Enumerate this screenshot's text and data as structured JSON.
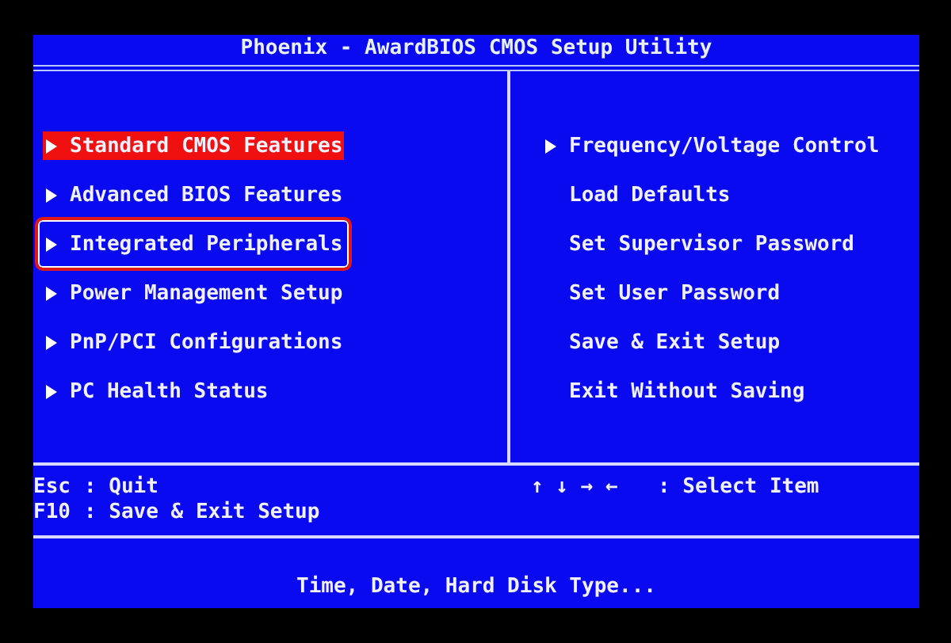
{
  "window": {
    "title": "Phoenix - AwardBIOS CMOS Setup Utility"
  },
  "left_menu": [
    {
      "label": "Standard CMOS Features",
      "arrow": true,
      "selected": true,
      "highlighted": false
    },
    {
      "label": "Advanced BIOS Features",
      "arrow": true,
      "selected": false,
      "highlighted": false
    },
    {
      "label": "Integrated Peripherals",
      "arrow": true,
      "selected": false,
      "highlighted": true
    },
    {
      "label": "Power Management Setup",
      "arrow": true,
      "selected": false,
      "highlighted": false
    },
    {
      "label": "PnP/PCI Configurations",
      "arrow": true,
      "selected": false,
      "highlighted": false
    },
    {
      "label": "PC Health Status",
      "arrow": true,
      "selected": false,
      "highlighted": false
    }
  ],
  "right_menu": [
    {
      "label": "Frequency/Voltage Control",
      "arrow": true,
      "selected": false,
      "highlighted": false
    },
    {
      "label": "Load Defaults",
      "arrow": false,
      "selected": false,
      "highlighted": false
    },
    {
      "label": "Set Supervisor Password",
      "arrow": false,
      "selected": false,
      "highlighted": false
    },
    {
      "label": "Set User Password",
      "arrow": false,
      "selected": false,
      "highlighted": false
    },
    {
      "label": "Save & Exit Setup",
      "arrow": false,
      "selected": false,
      "highlighted": false
    },
    {
      "label": "Exit Without Saving",
      "arrow": false,
      "selected": false,
      "highlighted": false
    }
  ],
  "key_help": {
    "left": [
      {
        "key": "Esc",
        "action": ": Quit"
      },
      {
        "key": "F10",
        "action": ": Save & Exit Setup"
      }
    ],
    "right": [
      {
        "key": "↑ ↓ → ←",
        "action": ": Select Item"
      }
    ]
  },
  "description": "Time, Date, Hard Disk Type..."
}
